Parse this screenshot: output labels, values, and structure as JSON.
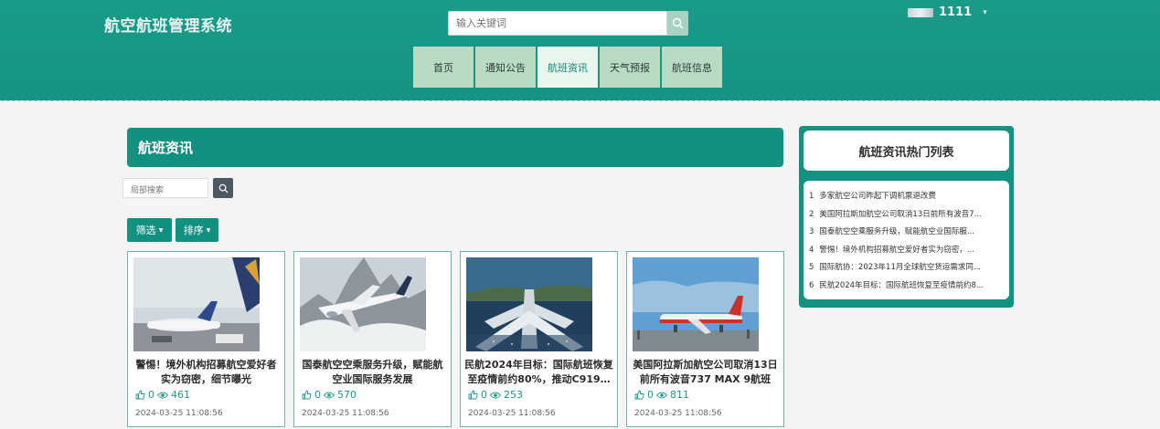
{
  "header": {
    "site_title": "航空航班管理系统",
    "search_placeholder": "输入关键词",
    "username": "1111",
    "user_caret": "▾"
  },
  "nav": [
    {
      "label": "首页",
      "active": false
    },
    {
      "label": "通知公告",
      "active": false
    },
    {
      "label": "航班资讯",
      "active": true
    },
    {
      "label": "天气预报",
      "active": false
    },
    {
      "label": "航班信息",
      "active": false
    }
  ],
  "main": {
    "section_title": "航班资讯",
    "local_search_placeholder": "局部搜索",
    "filter_label": "筛选",
    "sort_label": "排序",
    "caret": "▼"
  },
  "cards": [
    {
      "title": "警惕！境外机构招募航空爱好者实为窃密，细节曝光",
      "likes": "0",
      "views": "461",
      "date": "2024-03-25 11:08:56"
    },
    {
      "title": "国泰航空空乘服务升级，赋能航空业国际服务发展",
      "likes": "0",
      "views": "570",
      "date": "2024-03-25 11:08:56"
    },
    {
      "title": "民航2024年目标：国际航班恢复至疫情前约80%，推动C919…",
      "likes": "0",
      "views": "253",
      "date": "2024-03-25 11:08:56"
    },
    {
      "title": "美国阿拉斯加航空公司取消13日前所有波音737 MAX 9航班",
      "likes": "0",
      "views": "811",
      "date": "2024-03-25 11:08:56"
    }
  ],
  "sidebar": {
    "title": "航班资讯热门列表",
    "items": [
      {
        "num": "1",
        "text": "多家航空公司昨起下调机票退改费"
      },
      {
        "num": "2",
        "text": "美国阿拉斯加航空公司取消13日前所有波音7..."
      },
      {
        "num": "3",
        "text": "国泰航空空乘服务升级，赋能航空业国际服..."
      },
      {
        "num": "4",
        "text": "警惕！境外机构招募航空爱好者实为窃密，..."
      },
      {
        "num": "5",
        "text": "国际航协：2023年11月全球航空货运需求同..."
      },
      {
        "num": "6",
        "text": "民航2024年目标：国际航班恢复至疫情前约8..."
      }
    ]
  },
  "colors": {
    "primary": "#129080",
    "nav_bg": "#b9dbc4",
    "nav_active_bg": "#e9f6ee",
    "card_border": "#6fb8a8"
  }
}
